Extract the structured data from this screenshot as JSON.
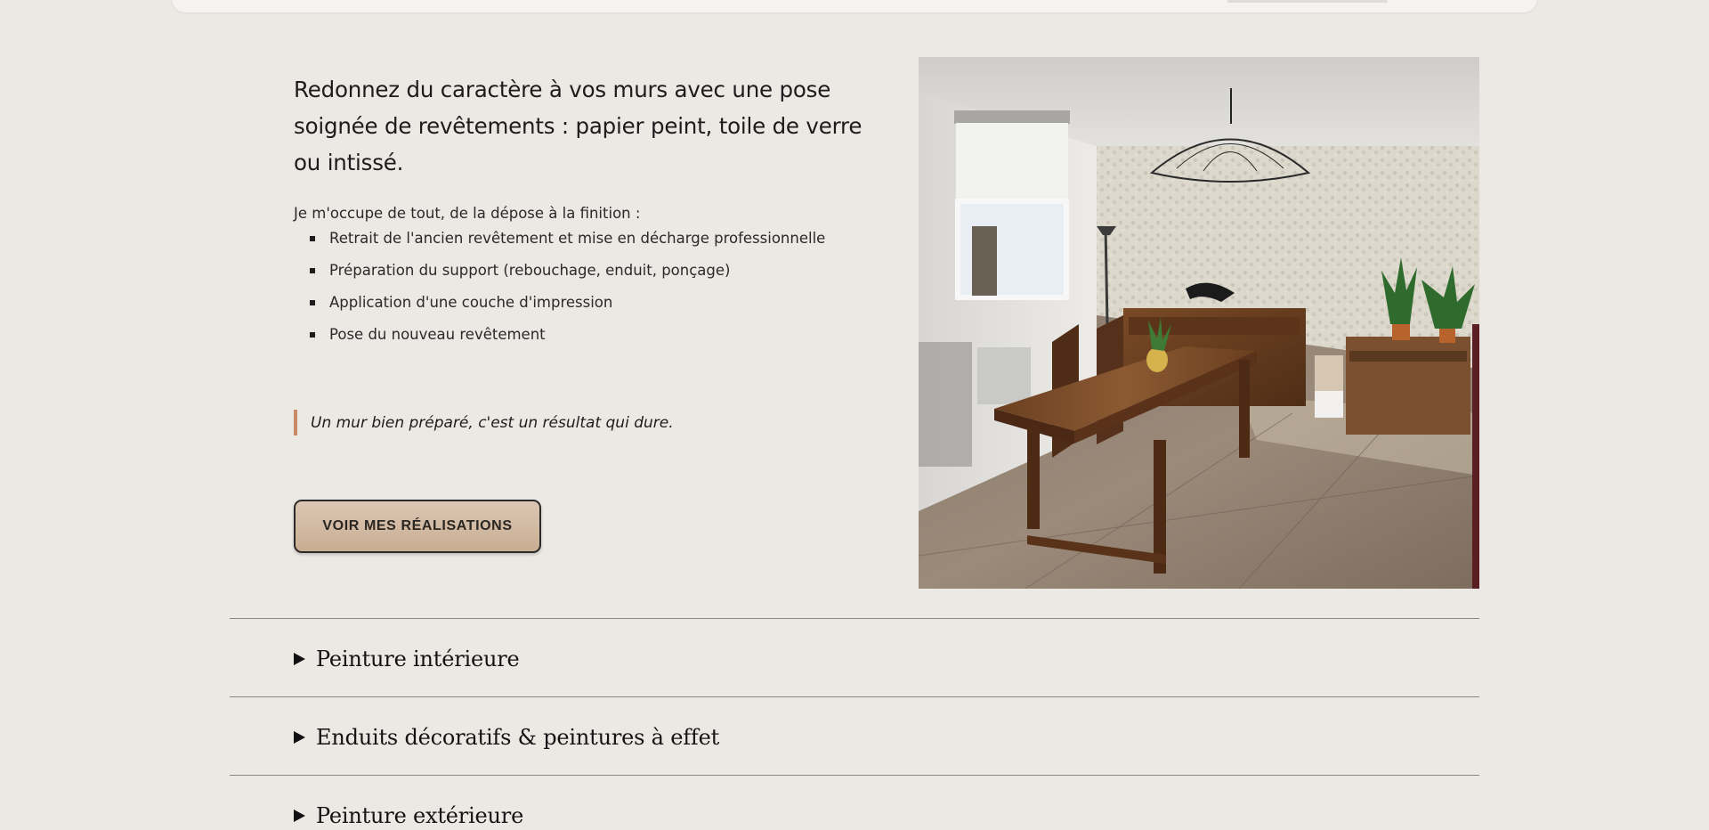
{
  "intro": {
    "heading": "Redonnez du caractère à vos murs avec une pose soignée de revêtements : papier peint, toile de verre ou intissé.",
    "lead": "Je m'occupe de tout, de la dépose à la finition :",
    "steps": [
      "Retrait de l'ancien revêtement et mise en décharge professionnelle",
      "Préparation du support (rebouchage, enduit, ponçage)",
      "Application d'une couche d'impression",
      "Pose du nouveau revêtement"
    ]
  },
  "quote": "Un mur bien préparé, c'est un résultat qui dure.",
  "cta": {
    "label": "VOIR MES RÉALISATIONS"
  },
  "accordion": {
    "items": [
      "Peinture intérieure",
      "Enduits décoratifs & peintures à effet",
      "Peinture extérieure"
    ]
  },
  "colors": {
    "background": "#ece8e4",
    "accent": "#c98b67",
    "button_fill": "#d2bba3",
    "text": "#1d1d1d"
  },
  "icons": {
    "bullet": "square-bullet-icon",
    "accordion_toggle": "caret-right-icon"
  }
}
